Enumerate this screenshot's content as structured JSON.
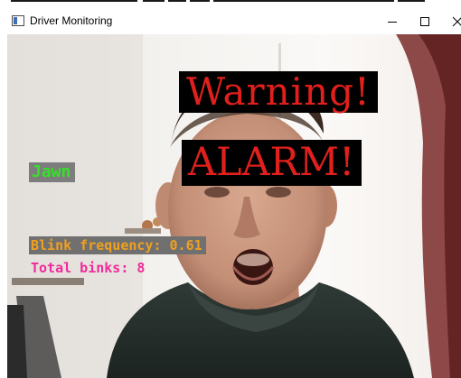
{
  "window": {
    "title": "Driver Monitoring",
    "minimize_symbol": "—",
    "maximize_symbol": "☐",
    "close_symbol": "✕"
  },
  "icons": {
    "app": "window-app-icon",
    "minimize": "minimize-icon",
    "maximize": "maximize-icon",
    "close": "close-icon"
  },
  "overlays": {
    "warning": "Warning!",
    "alarm": "ALARM!",
    "yawn": "Jawn",
    "blink_frequency": "Blink frequency: 0.61",
    "total_blinks": "Total binks: 8"
  },
  "colors": {
    "alert_red": "#e0201c",
    "yawn_green": "#36e02a",
    "blink_orange": "#f0a020",
    "blinks_pink": "#f02a9a"
  }
}
